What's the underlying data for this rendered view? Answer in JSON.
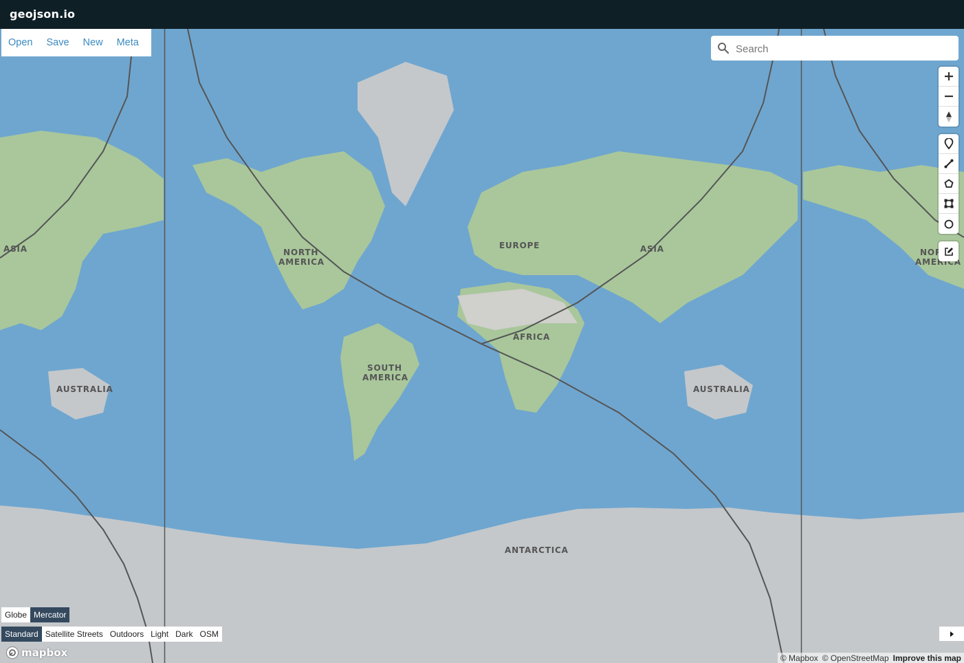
{
  "app": {
    "title": "geojson.io"
  },
  "file_menu": [
    "Open",
    "Save",
    "New",
    "Meta"
  ],
  "search": {
    "placeholder": "Search"
  },
  "map_labels": {
    "asia_left": "ASIA",
    "north_america_1": "NORTH",
    "north_america_2": "AMERICA",
    "europe": "EUROPE",
    "asia": "ASIA",
    "africa": "AFRICA",
    "south_america_1": "SOUTH",
    "south_america_2": "AMERICA",
    "australia_left": "AUSTRALIA",
    "australia_right": "AUSTRALIA",
    "antarctica": "ANTARCTICA",
    "north_america_right_1": "NOR",
    "north_america_right_2": "AMERICA"
  },
  "zoom_controls": [
    "zoom-in-icon",
    "zoom-out-icon",
    "compass-icon"
  ],
  "draw_tools": [
    "marker-icon",
    "line-icon",
    "polygon-icon",
    "rectangle-icon",
    "circle-icon"
  ],
  "edit_tools": [
    "edit-icon"
  ],
  "projection": {
    "options": [
      "Globe",
      "Mercator"
    ],
    "active": "Mercator"
  },
  "map_styles": {
    "options": [
      "Standard",
      "Satellite Streets",
      "Outdoors",
      "Light",
      "Dark",
      "OSM"
    ],
    "active": "Standard"
  },
  "logo": "mapbox",
  "attribution": {
    "mapbox": "© Mapbox",
    "osm": "© OpenStreetMap",
    "improve": "Improve this map"
  },
  "colors": {
    "topbar": "#0f1f26",
    "link": "#3b8ac0",
    "ocean": "#6fa6cf",
    "land": "#a9c79b",
    "ice": "#c4c8cb",
    "active": "#34495e"
  }
}
